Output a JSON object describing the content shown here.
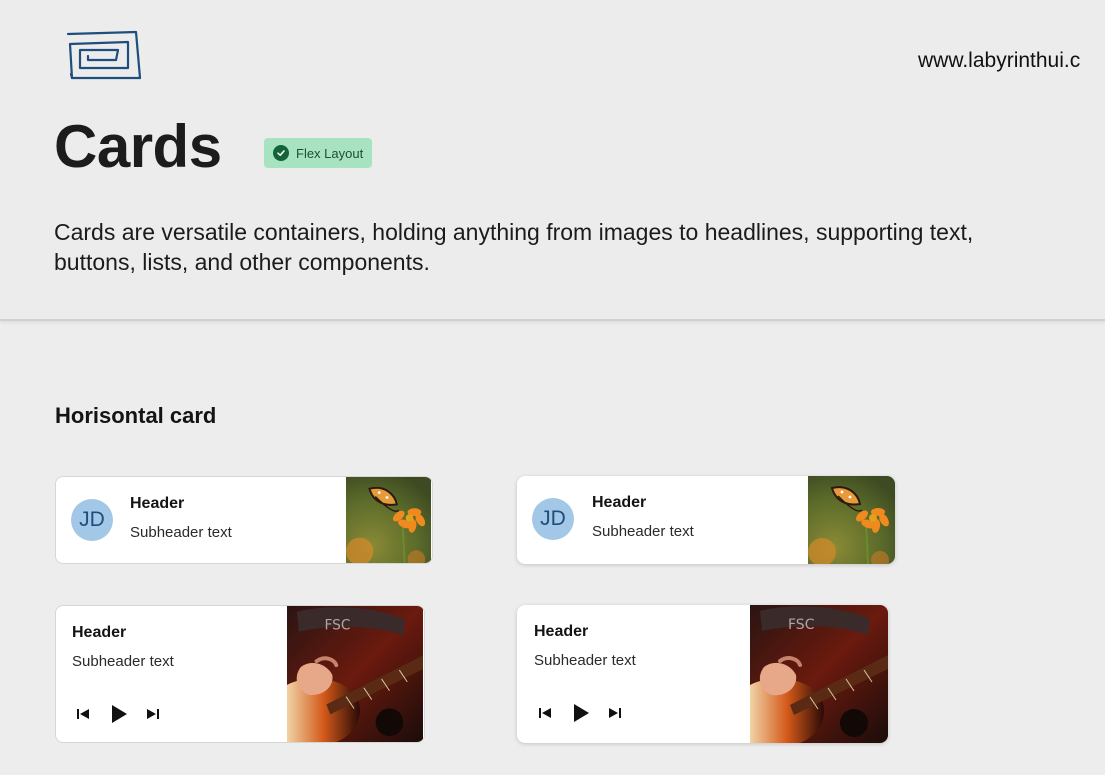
{
  "site": {
    "url": "www.labyrinthui.c",
    "logo_icon": "labyrinth-logo-icon"
  },
  "page": {
    "title": "Cards",
    "badge": {
      "label": "Flex Layout",
      "icon": "check-circle-icon",
      "color": "#a7e3c1"
    },
    "intro": "Cards are versatile containers, holding anything from images to headlines, supporting text, buttons, lists, and other components."
  },
  "section": {
    "title": "Horisontal card"
  },
  "cards": {
    "profile_outlined": {
      "avatar": "JD",
      "header": "Header",
      "subheader": "Subheader text",
      "image": "butterfly-on-flower-image"
    },
    "profile_elevated": {
      "avatar": "JD",
      "header": "Header",
      "subheader": "Subheader text",
      "image": "butterfly-on-flower-image"
    },
    "player_outlined": {
      "header": "Header",
      "subheader": "Subheader text",
      "image": "guitar-player-image",
      "controls": [
        "skip-previous-icon",
        "play-icon",
        "skip-next-icon"
      ]
    },
    "player_elevated": {
      "header": "Header",
      "subheader": "Subheader text",
      "image": "guitar-player-image",
      "controls": [
        "skip-previous-icon",
        "play-icon",
        "skip-next-icon"
      ]
    }
  }
}
